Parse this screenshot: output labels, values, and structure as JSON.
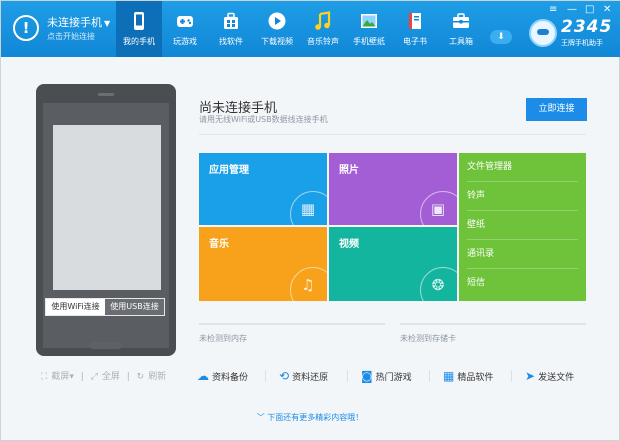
{
  "header": {
    "status_title": "未连接手机",
    "status_subtitle": "点击开始连接",
    "nav": [
      {
        "label": "我的手机",
        "icon": "phone-icon",
        "active": true
      },
      {
        "label": "玩游戏",
        "icon": "gamepad-icon",
        "active": false
      },
      {
        "label": "找软件",
        "icon": "apps-bag-icon",
        "active": false
      },
      {
        "label": "下载视频",
        "icon": "play-icon",
        "active": false
      },
      {
        "label": "音乐铃声",
        "icon": "music-note-icon",
        "active": false
      },
      {
        "label": "手机壁纸",
        "icon": "picture-icon",
        "active": false
      },
      {
        "label": "电子书",
        "icon": "book-icon",
        "active": false
      },
      {
        "label": "工具箱",
        "icon": "toolbox-icon",
        "active": false
      }
    ],
    "brand_number": "2345",
    "brand_tagline": "王牌手机助手",
    "window_controls": [
      "≡",
      "—",
      "□",
      "✕"
    ]
  },
  "phone": {
    "wifi_label": "使用WiFi连接",
    "usb_label": "使用USB连接",
    "actions": [
      "截屏▾",
      "全屏",
      "刷新"
    ]
  },
  "main": {
    "title": "尚未连接手机",
    "subtitle": "请用无线WiFi或USB数据线连接手机",
    "connect_button": "立即连接",
    "tiles": [
      {
        "label": "应用管理",
        "color": "#1aa0e8",
        "icon": "grid-icon"
      },
      {
        "label": "照片",
        "color": "#a35ed6",
        "icon": "photo-icon"
      },
      {
        "label": "音乐",
        "color": "#f7a21a",
        "icon": "music-icon"
      },
      {
        "label": "视频",
        "color": "#13b59e",
        "icon": "film-reel-icon"
      }
    ],
    "list_items": [
      "文件管理器",
      "铃声",
      "壁纸",
      "通讯录",
      "短信"
    ],
    "storage": [
      "未检测到内存",
      "未检测到存储卡"
    ],
    "bottom_actions": [
      {
        "label": "资料备份",
        "icon": "cloud-icon"
      },
      {
        "label": "资料还原",
        "icon": "restore-clock-icon"
      },
      {
        "label": "热门游戏",
        "icon": "gamepad-icon"
      },
      {
        "label": "精品软件",
        "icon": "apps-grid-icon"
      },
      {
        "label": "发送文件",
        "icon": "send-plane-icon"
      }
    ],
    "more_text": "下面还有更多精彩内容哦！"
  }
}
